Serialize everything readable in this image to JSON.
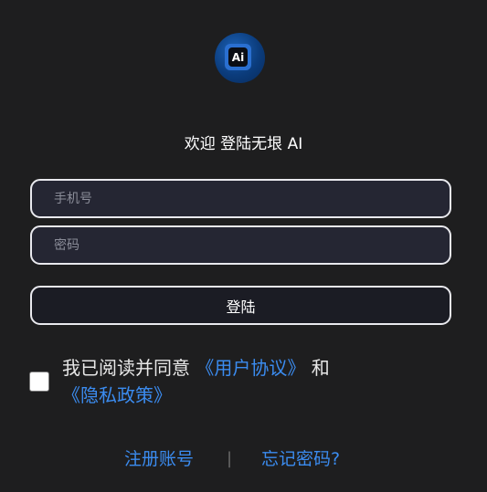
{
  "logo": {
    "text": "Ai"
  },
  "header": {
    "title": "欢迎 登陆无垠 AI"
  },
  "form": {
    "phone_placeholder": "手机号",
    "password_placeholder": "密码",
    "login_label": "登陆"
  },
  "agreement": {
    "checked": false,
    "prefix": "我已阅读并同意 ",
    "user_agreement": "《用户协议》",
    "and": " 和",
    "privacy_policy": "《隐私政策》"
  },
  "footer": {
    "register_label": "注册账号",
    "divider": "|",
    "forgot_label": "忘记密码?"
  },
  "colors": {
    "background": "#1e1e1f",
    "link": "#3b8cf0",
    "field_bg": "#252633",
    "border": "#e9e9ee"
  }
}
